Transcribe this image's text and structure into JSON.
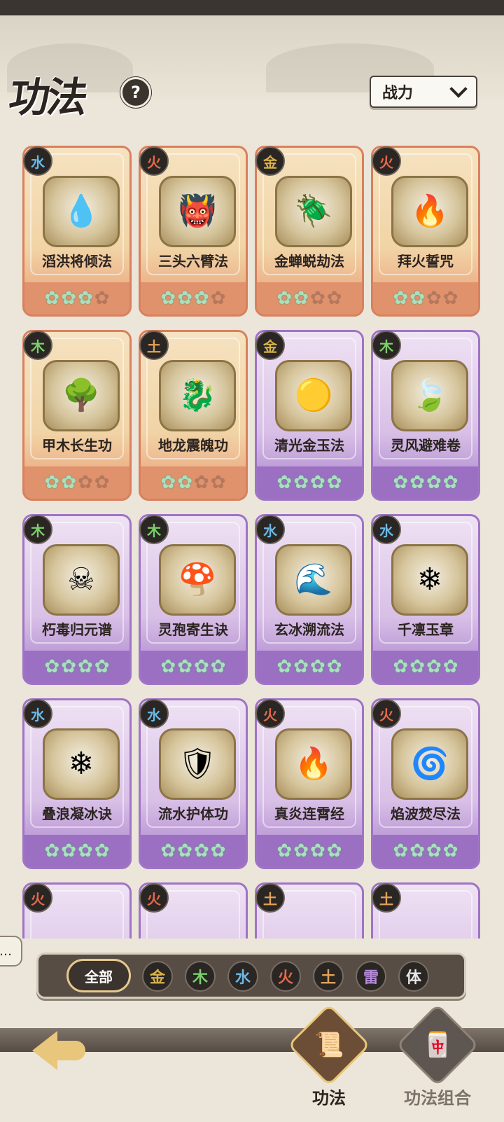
{
  "header": {
    "title": "功法",
    "help_label": "?",
    "sort_label": "战力"
  },
  "colors": {
    "metal": "#d8b24a",
    "wood": "#7bcf6a",
    "water": "#6ab8e6",
    "fire": "#e26a4c",
    "earth": "#e0a25a",
    "thunder": "#b58ad8",
    "body": "#e6e6e6"
  },
  "cards": [
    {
      "name": "滔洪将倾法",
      "element": "水",
      "rarity": "orange",
      "icon": "water-spirit-icon",
      "stars": 3,
      "max_stars": 4
    },
    {
      "name": "三头六臂法",
      "element": "火",
      "rarity": "orange",
      "icon": "demon-figure-icon",
      "stars": 3,
      "max_stars": 4
    },
    {
      "name": "金蝉蜕劫法",
      "element": "金",
      "rarity": "orange",
      "icon": "golden-cicada-icon",
      "stars": 2,
      "max_stars": 4
    },
    {
      "name": "拜火誓咒",
      "element": "火",
      "rarity": "orange",
      "icon": "fire-talisman-icon",
      "stars": 2,
      "max_stars": 4
    },
    {
      "name": "甲木长生功",
      "element": "木",
      "rarity": "orange",
      "icon": "green-tree-icon",
      "stars": 2,
      "max_stars": 4
    },
    {
      "name": "地龙震魄功",
      "element": "土",
      "rarity": "orange",
      "icon": "earth-dragon-icon",
      "stars": 2,
      "max_stars": 4
    },
    {
      "name": "清光金玉法",
      "element": "金",
      "rarity": "purple",
      "icon": "gold-orb-icon",
      "stars": 4,
      "max_stars": 4
    },
    {
      "name": "灵风避难卷",
      "element": "木",
      "rarity": "purple",
      "icon": "leaf-icon",
      "stars": 4,
      "max_stars": 4
    },
    {
      "name": "朽毒归元谱",
      "element": "木",
      "rarity": "purple",
      "icon": "poison-skull-icon",
      "stars": 4,
      "max_stars": 4
    },
    {
      "name": "灵孢寄生诀",
      "element": "木",
      "rarity": "purple",
      "icon": "spore-figure-icon",
      "stars": 4,
      "max_stars": 4
    },
    {
      "name": "玄冰溯流法",
      "element": "水",
      "rarity": "purple",
      "icon": "water-wave-icon",
      "stars": 4,
      "max_stars": 4
    },
    {
      "name": "千凛玉章",
      "element": "水",
      "rarity": "purple",
      "icon": "ice-shard-icon",
      "stars": 4,
      "max_stars": 4
    },
    {
      "name": "叠浪凝冰诀",
      "element": "水",
      "rarity": "purple",
      "icon": "ice-crystal-icon",
      "stars": 4,
      "max_stars": 4
    },
    {
      "name": "流水护体功",
      "element": "水",
      "rarity": "purple",
      "icon": "water-shield-icon",
      "stars": 4,
      "max_stars": 4
    },
    {
      "name": "真炎连霄经",
      "element": "火",
      "rarity": "purple",
      "icon": "flame-icon",
      "stars": 4,
      "max_stars": 4
    },
    {
      "name": "焰波焚尽法",
      "element": "火",
      "rarity": "purple",
      "icon": "fire-wave-icon",
      "stars": 4,
      "max_stars": 4
    },
    {
      "name": "",
      "element": "火",
      "rarity": "purple",
      "icon": "",
      "stars": 0,
      "max_stars": 4
    },
    {
      "name": "",
      "element": "火",
      "rarity": "purple",
      "icon": "",
      "stars": 0,
      "max_stars": 4
    },
    {
      "name": "",
      "element": "土",
      "rarity": "purple",
      "icon": "",
      "stars": 0,
      "max_stars": 4
    },
    {
      "name": "",
      "element": "土",
      "rarity": "purple",
      "icon": "",
      "stars": 0,
      "max_stars": 4
    }
  ],
  "filters": {
    "all_label": "全部",
    "elements": [
      "金",
      "木",
      "水",
      "火",
      "土",
      "雷",
      "体"
    ]
  },
  "nav": {
    "back_icon": "back-arrow-icon",
    "tab_active_label": "功法",
    "tab_inactive_label": "功法组合"
  }
}
